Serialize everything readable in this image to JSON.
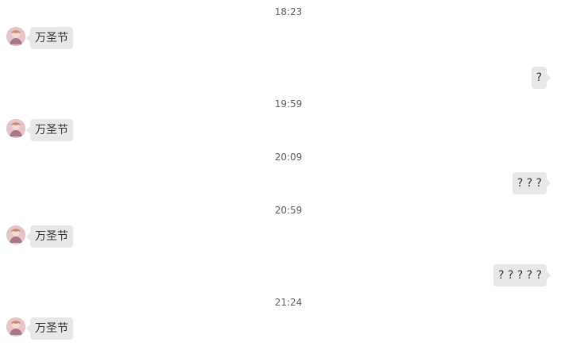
{
  "chat": {
    "messages": [
      {
        "kind": "time",
        "text": "18:23"
      },
      {
        "kind": "incoming",
        "text": "万圣节"
      },
      {
        "kind": "outgoing",
        "text": "?"
      },
      {
        "kind": "time",
        "text": "19:59"
      },
      {
        "kind": "incoming",
        "text": "万圣节"
      },
      {
        "kind": "time",
        "text": "20:09"
      },
      {
        "kind": "outgoing",
        "text": "? ? ?"
      },
      {
        "kind": "time",
        "text": "20:59"
      },
      {
        "kind": "incoming",
        "text": "万圣节"
      },
      {
        "kind": "outgoing",
        "text": "? ? ? ? ?"
      },
      {
        "kind": "time",
        "text": "21:24"
      },
      {
        "kind": "incoming",
        "text": "万圣节"
      }
    ]
  },
  "icons": {
    "avatar": "user-avatar-icon"
  }
}
